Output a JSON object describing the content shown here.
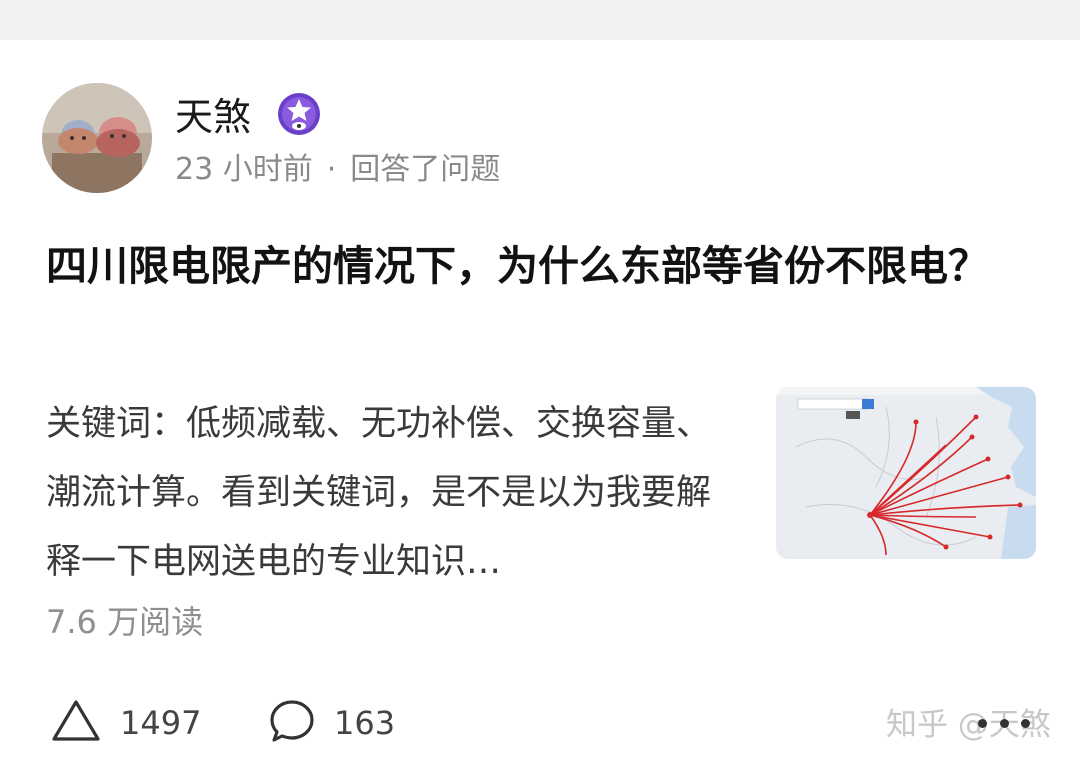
{
  "author": {
    "name": "天煞",
    "badge_icon": "star-badge-icon",
    "time_ago": "23 小时前",
    "separator": "·",
    "action_text": "回答了问题"
  },
  "question": {
    "title": "四川限电限产的情况下，为什么东部等省份不限电？"
  },
  "answer": {
    "excerpt": "关键词：低频减载、无功补偿、交换容量、潮流计算。看到关键词，是不是以为我要解释一下电网送电的专业知识…",
    "thumbnail_icon": "power-transmission-map-thumbnail"
  },
  "stats": {
    "reads": "7.6 万阅读",
    "likes": "1497",
    "comments": "163"
  },
  "watermark": "知乎 @天煞",
  "colors": {
    "badge_purple": "#6b3fc8",
    "map_lines": "#d7292b",
    "text_primary": "#121212",
    "text_secondary": "#8a8a8a"
  }
}
